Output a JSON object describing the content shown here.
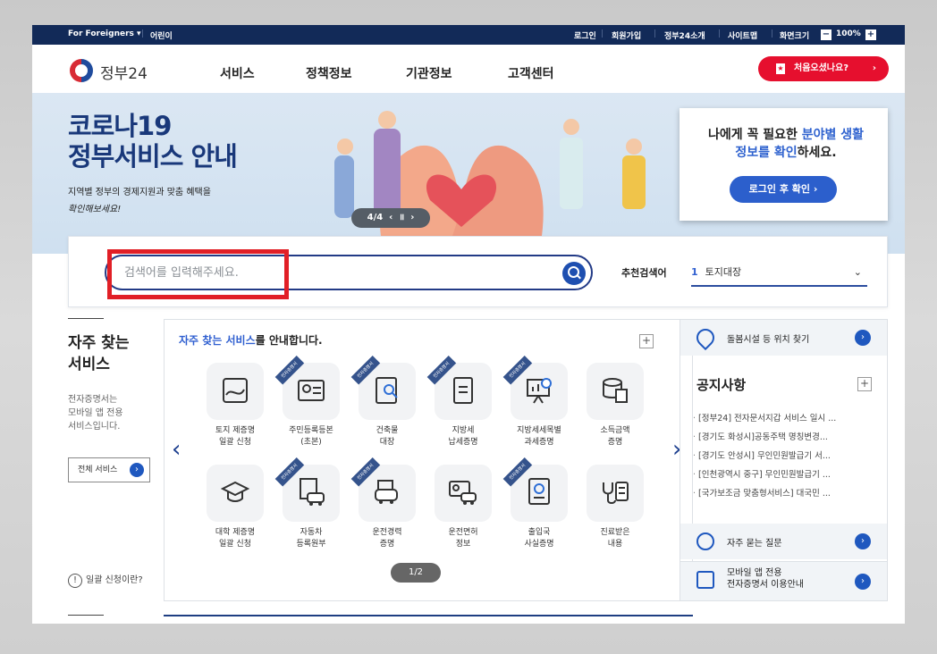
{
  "util": {
    "foreigners": "For Foreigners ▾",
    "kids": "어린이",
    "login": "로그인",
    "signup": "회원가입",
    "about": "정부24소개",
    "sitemap": "사이트맵",
    "zoom_label": "화면크기",
    "zoom_value": "100%"
  },
  "header": {
    "logo": "정부24",
    "nav": [
      "서비스",
      "정책정보",
      "기관정보",
      "고객센터"
    ],
    "first_visit": "처음오셨나요?"
  },
  "banner": {
    "title_line1": "코로나19",
    "title_line2": "정부서비스 안내",
    "subtitle_line1": "지역별 정부의 경제지원과 맞춤 혜택을",
    "subtitle_line2": "확인해보세요!",
    "pager": "4/4",
    "info_part1": "나에게 꼭 필요한 ",
    "info_highlight1": "분야별 생활",
    "info_highlight2": "정보를 확인",
    "info_part2": "하세요.",
    "login_button": "로그인 후 확인 ›"
  },
  "search": {
    "placeholder": "검색어를 입력해주세요.",
    "recommend_label": "추천검색어",
    "recommend_rank": "1",
    "recommend_term": "토지대장"
  },
  "frequent": {
    "title_line1": "자주 찾는",
    "title_line2": "서비스",
    "desc_line1": "전자증명서는",
    "desc_line2": "모바일 앱 전용",
    "desc_line3": "서비스입니다.",
    "all_button": "전체 서비스",
    "help": "일괄 신청이란?"
  },
  "services": {
    "title_highlight": "자주 찾는 서비스",
    "title_rest": "를 안내합니다.",
    "tag": "전자증명서",
    "items": [
      {
        "l1": "토지 제증명",
        "l2": "일괄 신청"
      },
      {
        "l1": "주민등록등본",
        "l2": "(초본)"
      },
      {
        "l1": "건축물",
        "l2": "대장"
      },
      {
        "l1": "지방세",
        "l2": "납세증명"
      },
      {
        "l1": "지방세세목별",
        "l2": "과세증명"
      },
      {
        "l1": "소득금액",
        "l2": "증명"
      },
      {
        "l1": "대학 제증명",
        "l2": "일괄 신청"
      },
      {
        "l1": "자동차",
        "l2": "등록원부"
      },
      {
        "l1": "운전경력",
        "l2": "증명"
      },
      {
        "l1": "운전면허",
        "l2": "정보"
      },
      {
        "l1": "출입국",
        "l2": "사실증명"
      },
      {
        "l1": "진료받은",
        "l2": "내용"
      }
    ],
    "pager": "1/2"
  },
  "right": {
    "facility": "돌봄시설 등 위치 찾기",
    "notice_title": "공지사항",
    "notices": [
      "[정부24] 전자문서지갑 서비스 일시 ...",
      "[경기도 화성시]공동주택 명칭변경...",
      "[경기도 안성시] 무인민원발급기 서...",
      "[인천광역시 중구] 무인민원발급기 ...",
      "[국가보조금 맞춤형서비스] 대국민 ..."
    ],
    "faq": "자주 묻는 질문",
    "mobile_line1": "모바일 앱 전용",
    "mobile_line2": "전자증명서 이용안내"
  }
}
